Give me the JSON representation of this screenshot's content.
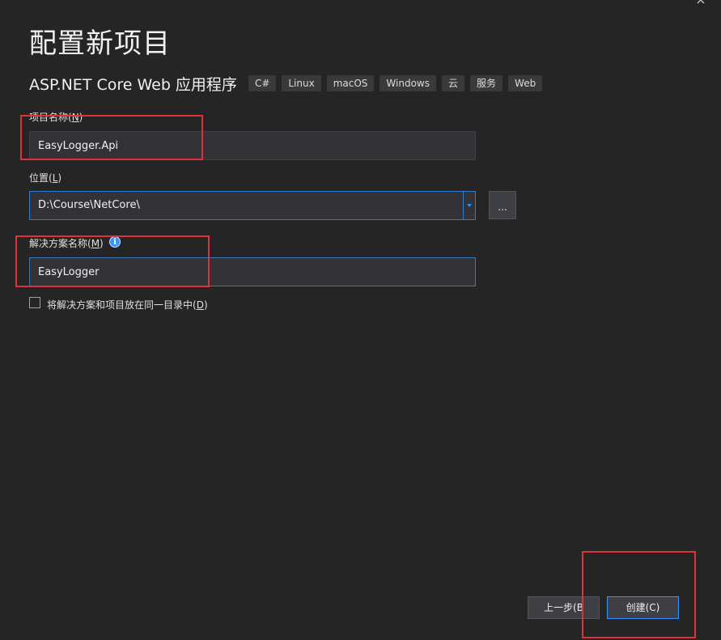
{
  "dialog": {
    "close_glyph": "×",
    "title": "配置新项目"
  },
  "template": {
    "name": "ASP.NET Core Web 应用程序",
    "tags": [
      "C#",
      "Linux",
      "macOS",
      "Windows",
      "云",
      "服务",
      "Web"
    ]
  },
  "project_name": {
    "label": "项目名称(",
    "mnemonic": "N",
    "label_end": ")",
    "value": "EasyLogger.Api"
  },
  "location": {
    "label": "位置(",
    "mnemonic": "L",
    "label_end": ")",
    "value": "D:\\Course\\NetCore\\",
    "browse_label": "..."
  },
  "solution_name": {
    "label": "解决方案名称(",
    "mnemonic": "M",
    "label_end": ")",
    "info_glyph": "i",
    "value": "EasyLogger"
  },
  "same_directory": {
    "label": "将解决方案和项目放在同一目录中(",
    "mnemonic": "D",
    "label_end": ")",
    "checked": false
  },
  "footer": {
    "back_label": "上一步(B",
    "create_label": "创建(C)"
  },
  "colors": {
    "background": "#252526",
    "input_background": "#333337",
    "focus_border": "#2f7bd1",
    "annotation_red": "#e0323a",
    "primary_border": "#3794ff"
  }
}
